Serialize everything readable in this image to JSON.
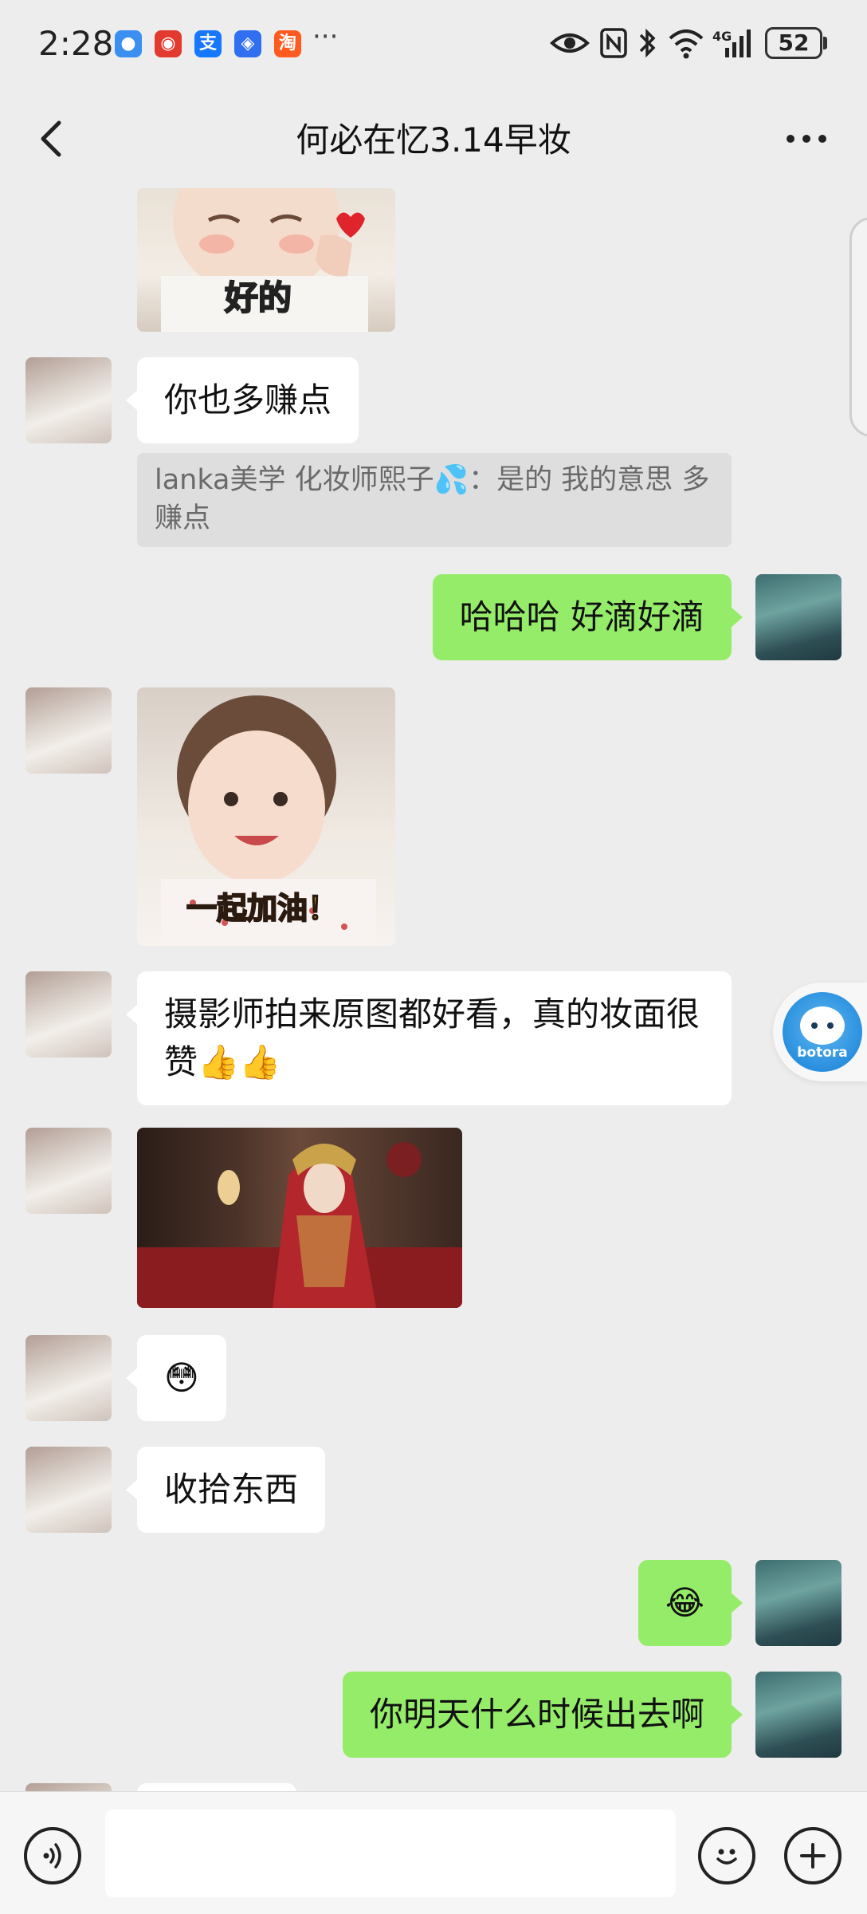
{
  "status_bar": {
    "time": "2:28",
    "more": "···",
    "network": "4G",
    "battery": "52"
  },
  "header": {
    "title": "何必在忆3.14早妆"
  },
  "messages": {
    "m1_caption": "好的",
    "m2_text": "你也多赚点",
    "m2_quote": "lanka美学  化妆师熙子💦：是的  我的意思 多赚点",
    "m3_text": "哈哈哈 好滴好滴",
    "m4_caption": "一起加油！",
    "m5_text": "摄影师拍来原图都好看，真的妆面很赞👍👍",
    "m7_text": "😳",
    "m8_text": "收拾东西",
    "m9_text": "😂",
    "m10_text": "你明天什么时候出去啊"
  },
  "floating": {
    "badge_text": "botora"
  },
  "input": {
    "value": ""
  },
  "colors": {
    "background": "#ededed",
    "outgoing_bubble": "#95ec69",
    "incoming_bubble": "#ffffff"
  }
}
